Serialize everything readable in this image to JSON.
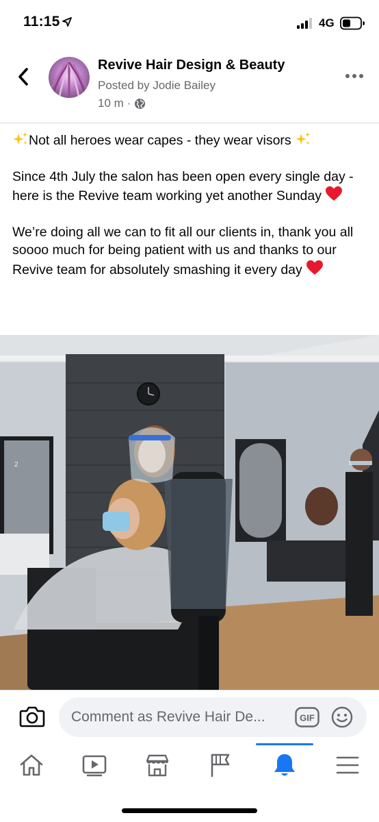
{
  "status_bar": {
    "time": "11:15",
    "network": "4G"
  },
  "post": {
    "page_name": "Revive Hair Design & Beauty",
    "posted_by": "Posted by Jodie Bailey",
    "time_ago": "10 m",
    "meta_separator": "·",
    "paragraphs": {
      "p1": "Not all heroes wear capes - they wear visors",
      "p2": "Since 4th July the salon has been open every single day - here is the Revive team working yet another Sunday",
      "p3": "We’re doing all we can to fit all our clients in, thank you all soooo much for being patient with us and thanks to our Revive team for absolutely smashing it every day"
    },
    "photo_mirror_label": "2"
  },
  "comment_bar": {
    "placeholder": "Comment as Revive Hair De...",
    "gif_label": "GIF"
  },
  "tabs": [
    {
      "icon": "home-icon",
      "active": false
    },
    {
      "icon": "video-icon",
      "active": false
    },
    {
      "icon": "marketplace-icon",
      "active": false
    },
    {
      "icon": "pages-flag-icon",
      "active": false
    },
    {
      "icon": "notifications-bell-icon",
      "active": true
    },
    {
      "icon": "menu-icon",
      "active": false
    }
  ],
  "colors": {
    "accent": "#1877f2",
    "secondary_text": "#65676b",
    "input_bg": "#f0f2f5",
    "heart": "#e8192c",
    "sparkle": "#f5c518"
  }
}
